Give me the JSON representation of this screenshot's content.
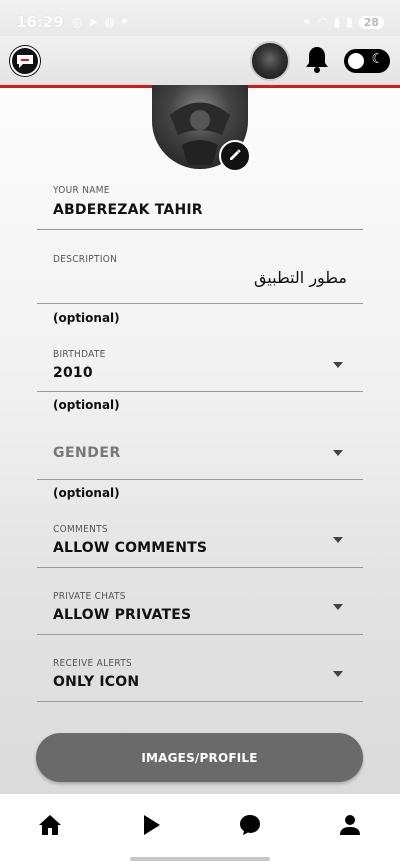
{
  "status_bar": {
    "time": "16:29",
    "battery": "28",
    "icons_left": [
      "notification-icon",
      "telegram-icon",
      "messenger-icon",
      "dot-icon"
    ],
    "icons_right": [
      "link-icon",
      "wifi-icon",
      "signal-icon",
      "signal-icon",
      "battery-icon"
    ]
  },
  "app_bar": {
    "logo_icon": "chat-logo-icon",
    "notification_icon": "bell-icon",
    "theme_toggle_icon": "moon-icon"
  },
  "profile": {
    "edit_icon": "pencil-icon"
  },
  "form": {
    "name": {
      "label": "YOUR NAME",
      "value": "ABDEREZAK TAHIR"
    },
    "description": {
      "label": "DESCRIPTION",
      "value": "مطور التطبيق",
      "hint": "(optional)"
    },
    "birthdate": {
      "label": "BIRTHDATE",
      "value": "2010",
      "hint": "(optional)"
    },
    "gender": {
      "placeholder": "GENDER",
      "hint": "(optional)"
    },
    "comments": {
      "label": "COMMENTS",
      "value": "ALLOW COMMENTS"
    },
    "private_chats": {
      "label": "PRIVATE CHATS",
      "value": "ALLOW PRIVATES"
    },
    "receive_alerts": {
      "label": "RECEIVE ALERTS",
      "value": "ONLY ICON"
    }
  },
  "actions": {
    "images_profile_label": "IMAGES/PROFILE"
  },
  "bottom_nav": {
    "items": [
      "home-icon",
      "play-icon",
      "chat-icon",
      "person-icon"
    ]
  },
  "colors": {
    "accent_red": "#d11a1a",
    "button_gray": "#6a6a6a"
  }
}
